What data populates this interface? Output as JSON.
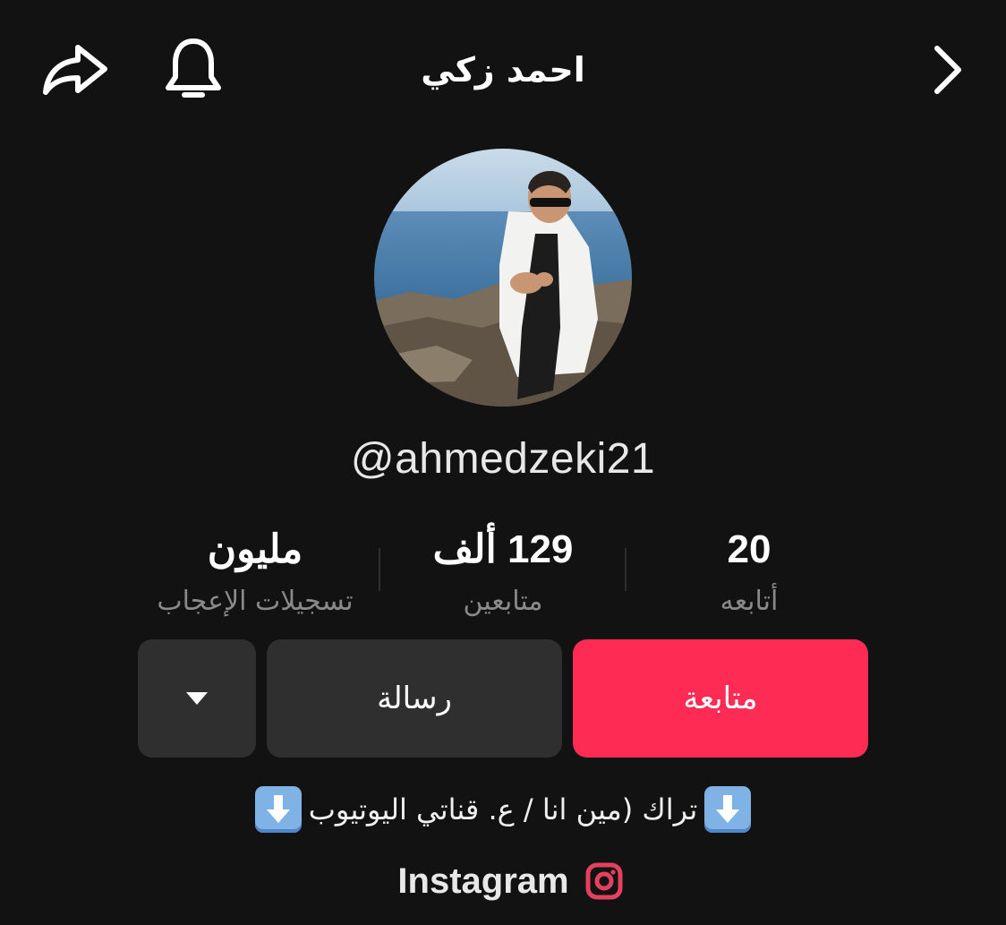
{
  "header": {
    "title": "احمد زكي",
    "icons": {
      "share": "share-icon",
      "bell": "bell-icon",
      "back": "chevron-right-icon"
    }
  },
  "profile": {
    "username": "@ahmedzeki21"
  },
  "stats": [
    {
      "value": "20",
      "label": "أتابعه"
    },
    {
      "value": "129 ألف",
      "label": "متابعين"
    },
    {
      "value": "مليون",
      "label": "تسجيلات الإعجاب"
    }
  ],
  "actions": {
    "follow_label": "متابعة",
    "message_label": "رسالة",
    "more_icon": "caret-down-icon"
  },
  "bio": {
    "text": "تراك (مين انا / ع. قناتي اليوتيوب",
    "emoji": "down-arrow-emoji"
  },
  "link": {
    "label": "Instagram",
    "icon": "instagram-icon"
  },
  "colors": {
    "background": "#121212",
    "accent": "#fe2c55",
    "secondary_button": "#2f2f2f",
    "muted_text": "#8a8a8a",
    "instagram": "#e4405f"
  }
}
